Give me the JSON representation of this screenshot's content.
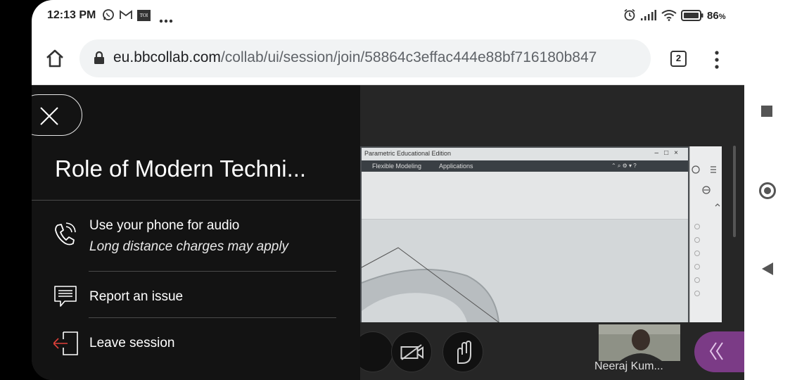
{
  "status_bar": {
    "time": "12:13 PM",
    "battery_percent": "86",
    "battery_unit": "%",
    "notification_icons": [
      "whatsapp-icon",
      "gmail-icon",
      "toi-icon",
      "more-notifications-icon"
    ],
    "system_icons": [
      "alarm-icon",
      "signal-icon",
      "wifi-icon",
      "battery-icon"
    ],
    "toi_label": "TOI"
  },
  "browser": {
    "url_host": "eu.bbcollab.com",
    "url_path": "/collab/ui/session/join/58864c3effac444e88bf716180b847",
    "tab_count": "2"
  },
  "session_panel": {
    "title": "Role of Modern Techni...",
    "items": [
      {
        "label": "Use your phone for audio",
        "sublabel": "Long distance charges may apply",
        "icon": "phone-icon"
      },
      {
        "label": "Report an issue",
        "icon": "report-issue-icon"
      },
      {
        "label": "Leave session",
        "icon": "leave-session-icon"
      }
    ]
  },
  "shared_screen": {
    "window_title": "Parametric Educational Edition",
    "menu": [
      "Flexible Modeling",
      "Applications"
    ]
  },
  "participant": {
    "name": "Neeraj Kum..."
  },
  "colors": {
    "panel_bg": "#131313",
    "stage_bg": "#262626",
    "accent_purple": "#7b3b86",
    "leave_icon_red": "#e0403a"
  }
}
